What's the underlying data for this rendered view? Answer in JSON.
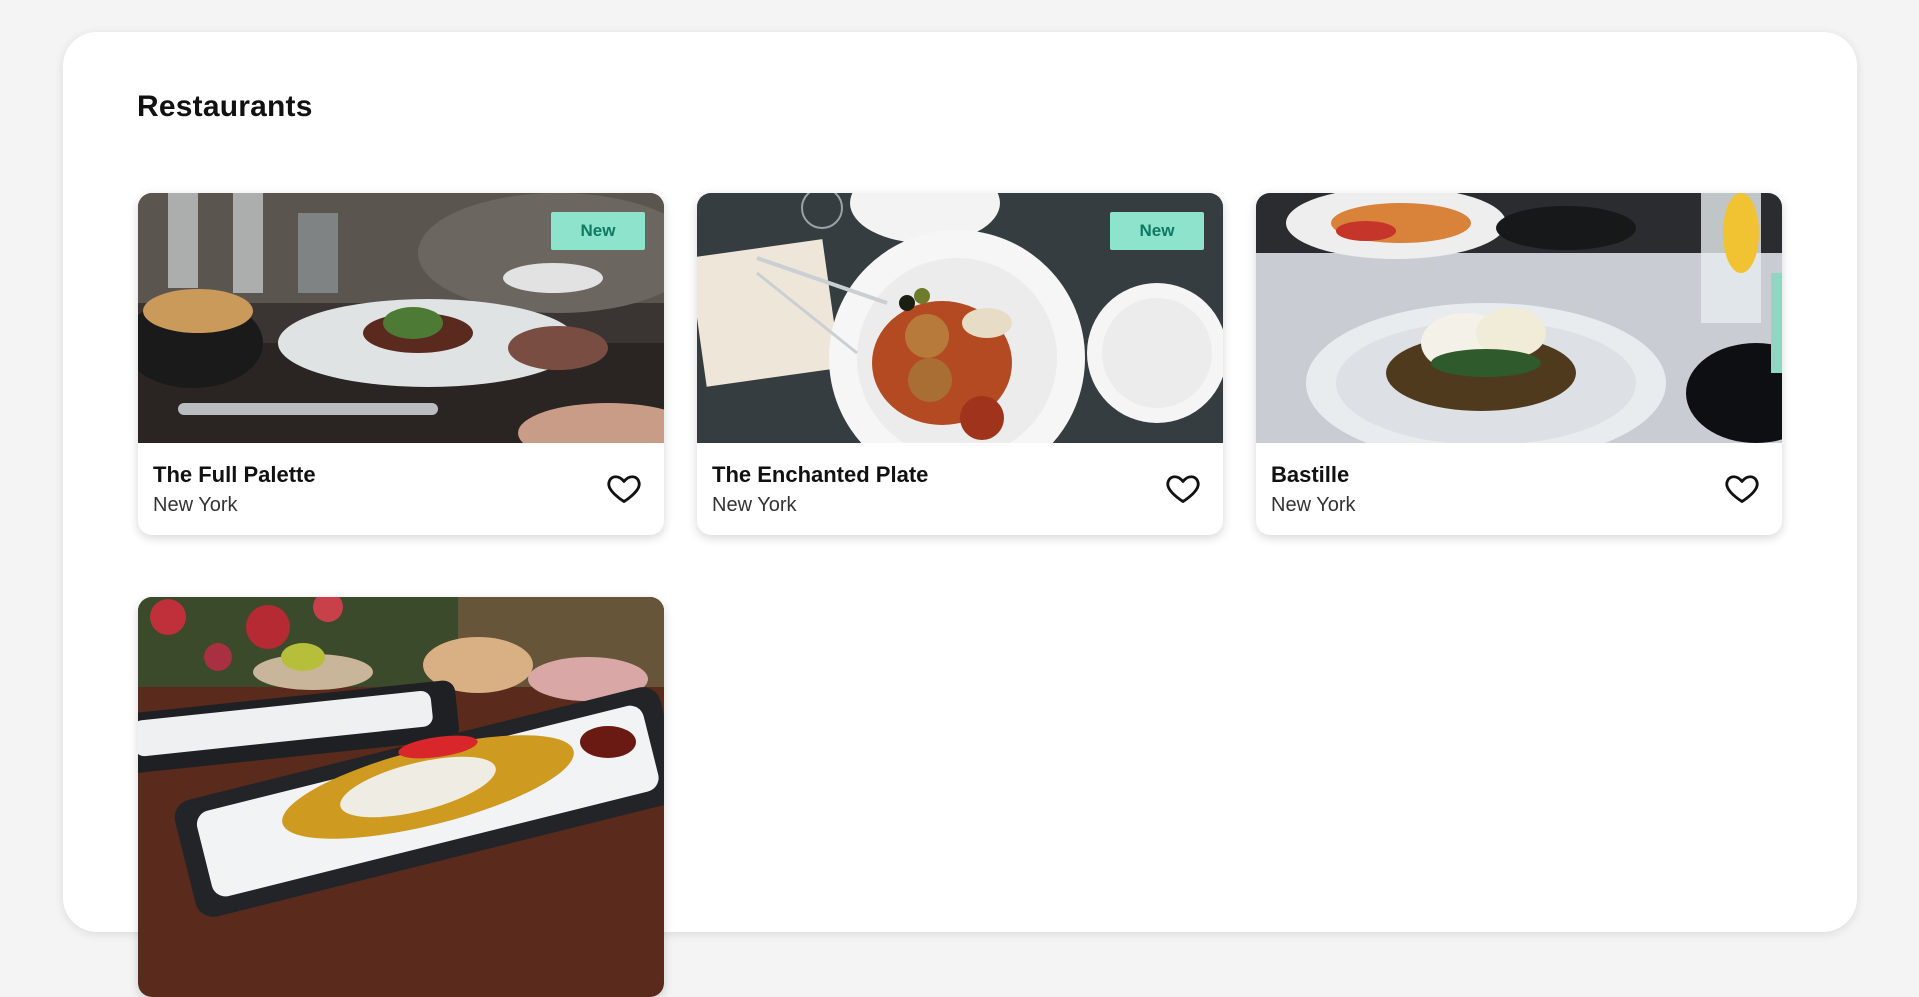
{
  "page": {
    "title": "Restaurants"
  },
  "restaurants": [
    {
      "name": "The Full Palette",
      "city": "New York",
      "badge": "New",
      "icon": "heart-outline-icon"
    },
    {
      "name": "The Enchanted Plate",
      "city": "New York",
      "badge": "New",
      "icon": "heart-outline-icon"
    },
    {
      "name": "Bastille",
      "city": "New York",
      "badge": "",
      "icon": "heart-outline-icon"
    },
    {
      "name": "",
      "city": "",
      "badge": "",
      "icon": ""
    }
  ],
  "colors": {
    "background": "#f4f4f4",
    "panel": "#ffffff",
    "badge_bg": "#8ee3cc",
    "badge_text": "#0d7a62"
  }
}
